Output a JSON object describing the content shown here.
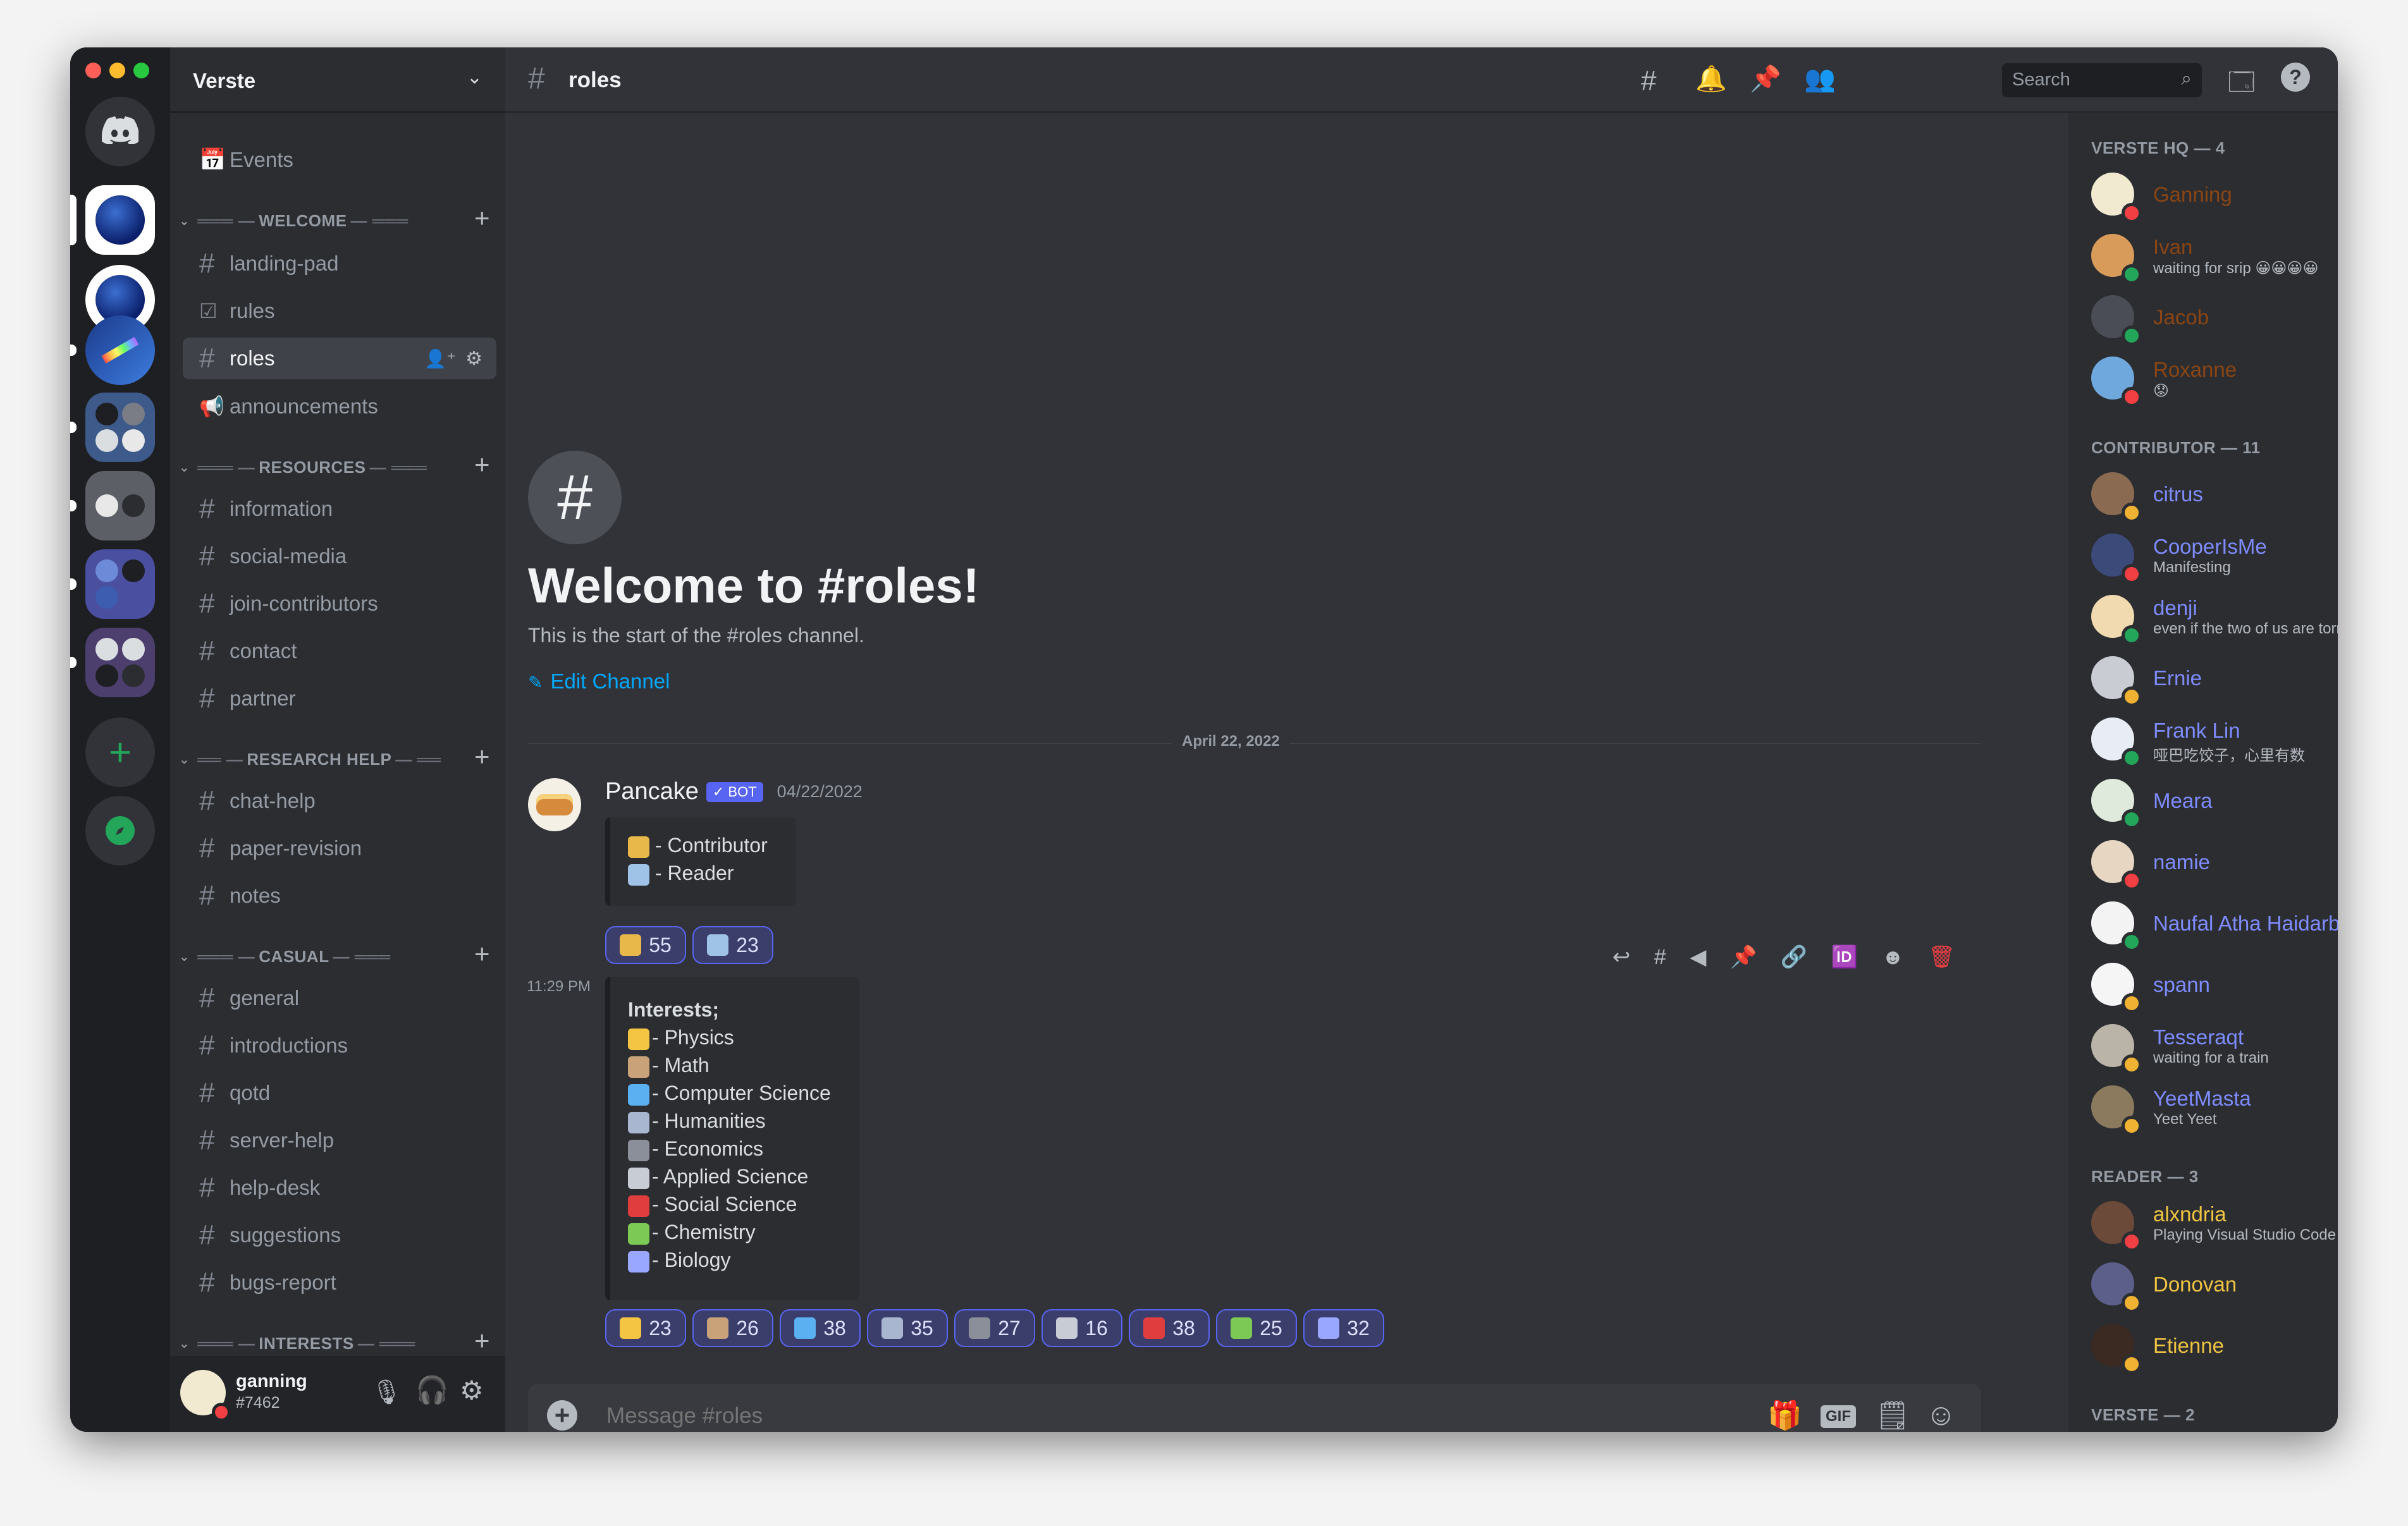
{
  "server": {
    "name": "Verste",
    "events_label": "Events"
  },
  "categories": {
    "welcome": "WELCOME",
    "resources": "RESOURCES",
    "research_help": "RESEARCH HELP",
    "casual": "CASUAL",
    "interests": "INTERESTS"
  },
  "channels": {
    "landing_pad": "landing-pad",
    "rules": "rules",
    "roles": "roles",
    "announcements": "announcements",
    "information": "information",
    "social_media": "social-media",
    "join_contributors": "join-contributors",
    "contact": "contact",
    "partner": "partner",
    "chat_help": "chat-help",
    "paper_revision": "paper-revision",
    "notes": "notes",
    "general": "general",
    "introductions": "introductions",
    "qotd": "qotd",
    "server_help": "server-help",
    "help_desk": "help-desk",
    "suggestions": "suggestions",
    "bugs_report": "bugs-report"
  },
  "user_panel": {
    "username": "ganning",
    "tag": "#7462"
  },
  "topbar": {
    "channel_name": "roles",
    "search_placeholder": "Search"
  },
  "welcome": {
    "title": "Welcome to #roles!",
    "subtitle": "This is the start of the #roles channel.",
    "edit_label": "Edit Channel",
    "date_divider": "April 22, 2022"
  },
  "message": {
    "author": "Pancake",
    "bot_badge": "✓ BOT",
    "timestamp": "04/22/2022",
    "second_time": "11:29 PM",
    "embed1": {
      "lines": [
        "- Contributor",
        "- Reader"
      ]
    },
    "embed1_reactions": [
      {
        "count": "55",
        "color": "#e8b84a"
      },
      {
        "count": "23",
        "color": "#9fc3e7"
      }
    ],
    "embed2": {
      "heading": "Interests;",
      "lines": [
        "- Physics",
        "- Math",
        "- Computer Science",
        "- Humanities",
        "- Economics",
        "- Applied Science",
        "- Social Science",
        "- Chemistry",
        "- Biology"
      ],
      "line_colors": [
        "#f4c542",
        "#c9a27a",
        "#5ab0f0",
        "#a9b6d0",
        "#8a8f99",
        "#c8ccd4",
        "#e03e3e",
        "#7dc956",
        "#9aa7ff"
      ]
    },
    "embed2_reactions": [
      {
        "count": "23",
        "color": "#f4c542"
      },
      {
        "count": "26",
        "color": "#c9a27a"
      },
      {
        "count": "38",
        "color": "#5ab0f0"
      },
      {
        "count": "35",
        "color": "#a9b6d0"
      },
      {
        "count": "27",
        "color": "#8a8f99"
      },
      {
        "count": "16",
        "color": "#c8ccd4"
      },
      {
        "count": "38",
        "color": "#e03e3e"
      },
      {
        "count": "25",
        "color": "#7dc956"
      },
      {
        "count": "32",
        "color": "#9aa7ff"
      }
    ]
  },
  "composer": {
    "placeholder": "Message #roles",
    "gif_label": "GIF"
  },
  "members": {
    "groups": [
      {
        "title": "VERSTE HQ — 4",
        "members": [
          {
            "name": "Ganning",
            "sub": "",
            "color": "#8b4513",
            "status": "#f23f43",
            "avatar": "#f1e9d0"
          },
          {
            "name": "Ivan",
            "sub": "waiting for srip 😀😀😀😀",
            "color": "#8b4513",
            "status": "#23a55a",
            "avatar": "#d99b5a"
          },
          {
            "name": "Jacob",
            "sub": "",
            "color": "#8b4513",
            "status": "#23a55a",
            "avatar": "#4a4d55"
          },
          {
            "name": "Roxanne",
            "sub": "😟",
            "color": "#8b4513",
            "status": "#f23f43",
            "avatar": "#6fa8dc"
          }
        ]
      },
      {
        "title": "CONTRIBUTOR — 11",
        "members": [
          {
            "name": "citrus",
            "sub": "",
            "color": "#7f8cff",
            "status": "#f0b232",
            "avatar": "#8a6a50"
          },
          {
            "name": "CooperIsMe",
            "sub": "Manifesting",
            "color": "#7f8cff",
            "status": "#f23f43",
            "avatar": "#3c4a7a"
          },
          {
            "name": "denji",
            "sub": "even if the two of us are torn a...",
            "color": "#7f8cff",
            "status": "#23a55a",
            "avatar": "#f1d9b0"
          },
          {
            "name": "Ernie",
            "sub": "",
            "color": "#7f8cff",
            "status": "#f0b232",
            "avatar": "#c9ccd2"
          },
          {
            "name": "Frank Lin",
            "sub": "哑巴吃饺子，心里有数",
            "color": "#7f8cff",
            "status": "#23a55a",
            "avatar": "#e8edf5"
          },
          {
            "name": "Meara",
            "sub": "",
            "color": "#7f8cff",
            "status": "#23a55a",
            "avatar": "#dfe9dc"
          },
          {
            "name": "namie",
            "sub": "",
            "color": "#7f8cff",
            "status": "#f23f43",
            "avatar": "#e6d6c2"
          },
          {
            "name": "Naufal Atha Haidarbahy",
            "sub": "",
            "color": "#7f8cff",
            "status": "#23a55a",
            "avatar": "#f3f3f3"
          },
          {
            "name": "spann",
            "sub": "",
            "color": "#7f8cff",
            "status": "#f0b232",
            "avatar": "#f5f5f5"
          },
          {
            "name": "Tesseraqt",
            "sub": "waiting for a train",
            "color": "#7f8cff",
            "status": "#f0b232",
            "avatar": "#b9b3a8"
          },
          {
            "name": "YeetMasta",
            "sub": "Yeet Yeet",
            "color": "#7f8cff",
            "status": "#f0b232",
            "avatar": "#8c7a5e"
          }
        ]
      },
      {
        "title": "READER — 3",
        "members": [
          {
            "name": "alxndria",
            "sub": "Playing Visual Studio Code",
            "color": "#f0c442",
            "status": "#f23f43",
            "avatar": "#6b4a3a"
          },
          {
            "name": "Donovan",
            "sub": "",
            "color": "#f0c442",
            "status": "#f0b232",
            "avatar": "#5b5f8a"
          },
          {
            "name": "Etienne",
            "sub": "",
            "color": "#f0c442",
            "status": "#f0b232",
            "avatar": "#3a2a22"
          }
        ]
      },
      {
        "title": "VERSTE — 2",
        "members": []
      }
    ]
  }
}
